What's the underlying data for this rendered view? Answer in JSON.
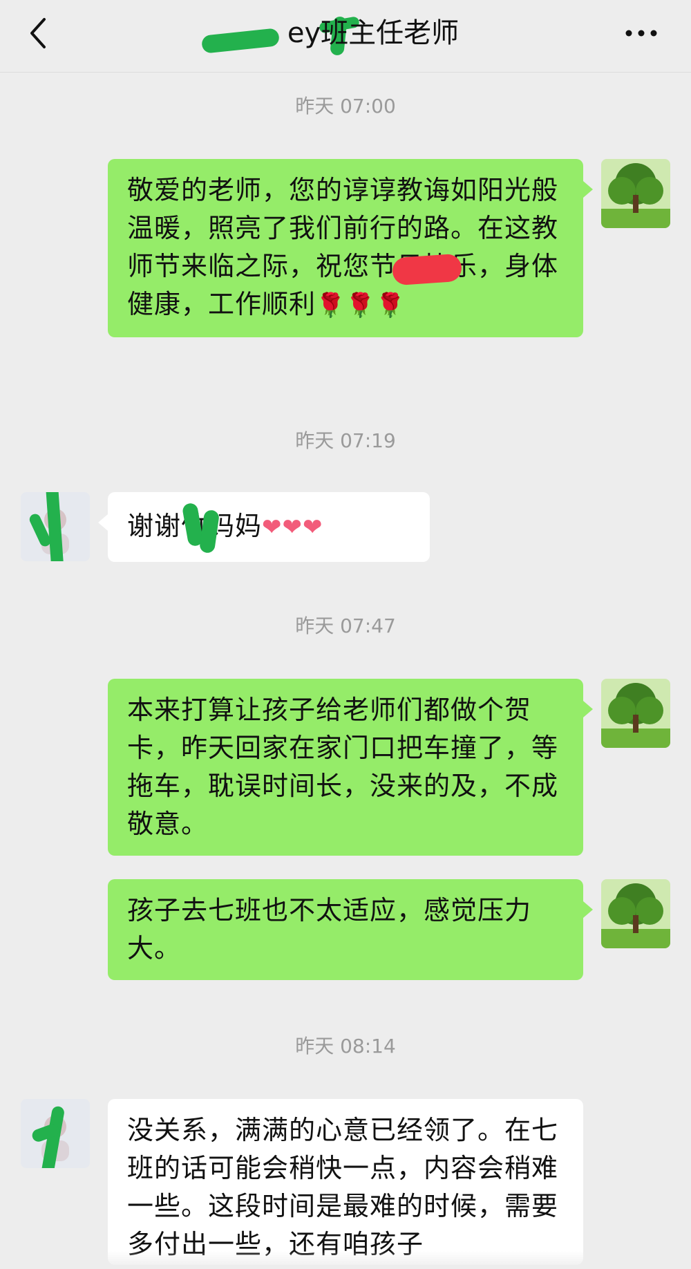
{
  "header": {
    "title": "ey班主任老师"
  },
  "messages": [
    {
      "time": "昨天 07:00"
    },
    {
      "text": "敬爱的老师，您的谆谆教诲如阳光般温暖，照亮了我们前行的路。在这教师节来临之际，祝您节日快乐，身体健康，工作顺利",
      "emoji": "🌹🌹🌹"
    },
    {
      "time": "昨天 07:19"
    },
    {
      "text": "谢谢竹妈妈",
      "emoji": "❤❤❤"
    },
    {
      "time": "昨天 07:47"
    },
    {
      "text": "本来打算让孩子给老师们都做个贺卡，昨天回家在家门口把车撞了，等拖车，耽误时间长，没来的及，不成敬意。"
    },
    {
      "text": "孩子去七班也不太适应，感觉压力大。"
    },
    {
      "time": "昨天 08:14"
    },
    {
      "text": "没关系，满满的心意已经领了。在七班的话可能会稍快一点，内容会稍难一些。这段时间是最难的时候，需要多付出一些，还有咱孩子"
    }
  ],
  "colors": {
    "background": "#ededed",
    "self_bubble": "#95ec69",
    "other_bubble": "#ffffff",
    "timestamp": "#9a9a9a",
    "redaction_green": "#23b14d",
    "redaction_red": "#f03745"
  },
  "icons": [
    "chevron-left-icon",
    "more-dots-icon",
    "tree-avatar-icon",
    "contact-avatar-icon",
    "rose-emoji",
    "heart-emoji"
  ]
}
